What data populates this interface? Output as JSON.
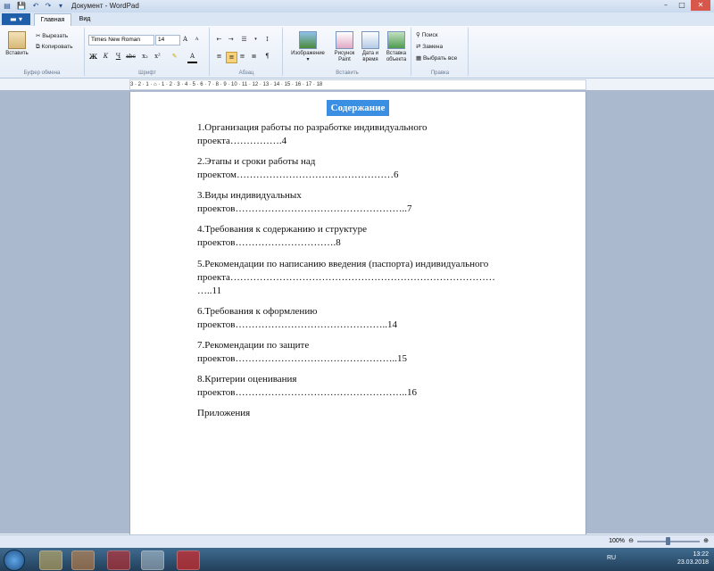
{
  "window": {
    "title": "Документ - WordPad",
    "min": "–",
    "max": "□",
    "close": "✕"
  },
  "tabs": {
    "file": "▬ ▾",
    "home": "Главная",
    "view": "Вид"
  },
  "ribbon": {
    "clipboard": {
      "label": "Буфер обмена",
      "paste": "Вставить",
      "cut": "Вырезать",
      "copy": "Копировать"
    },
    "font": {
      "label": "Шрифт",
      "family": "Times New Roman",
      "size": "14",
      "bold": "Ж",
      "italic": "К",
      "underline": "Ч",
      "strike": "abc",
      "sub": "x₂",
      "sup": "x²",
      "highlight": "✎",
      "color": "A"
    },
    "paragraph": {
      "label": "Абзац"
    },
    "insert": {
      "label": "Вставить",
      "image": "Изображение",
      "paint_line1": "Рисунок",
      "paint_line2": "Paint",
      "date_line1": "Дата и",
      "date_line2": "время",
      "object_line1": "Вставка",
      "object_line2": "объекта"
    },
    "editing": {
      "label": "Правка",
      "find": "Поиск",
      "replace": "Замена",
      "select_all": "Выбрать все"
    }
  },
  "ruler": "3 · 2 · 1 · ⌂ · 1 · 2 · 3 · 4 · 5 · 6 · 7 · 8 · 9 · 10 · 11 · 12 · 13 · 14 · 15 · 16 · 17 · 18",
  "document": {
    "heading": "Содержание",
    "items": [
      {
        "line1": "1.Организация работы по разработке индивидуального",
        "line2": "проекта…………….4",
        "line3": ""
      },
      {
        "line1": "2.Этапы и сроки работы над",
        "line2": "проектом…………………………………………6",
        "line3": ""
      },
      {
        "line1": "3.Виды индивидуальных",
        "line2": "проектов……………………………………………..7",
        "line3": ""
      },
      {
        "line1": "4.Требования к содержанию и структуре",
        "line2": "проектов………………………….8",
        "line3": ""
      },
      {
        "line1": "5.Рекомендации по написанию введения (паспорта)  индивидуального",
        "line2": "проекта………………………………………………………………………",
        "line3": "…..11"
      },
      {
        "line1": "6.Требования к оформлению",
        "line2": "проектов………………………………………..14",
        "line3": ""
      },
      {
        "line1": "7.Рекомендации по защите",
        "line2": "проектов…………………………………………..15",
        "line3": ""
      },
      {
        "line1": "8.Критерии оценивания",
        "line2": "проектов……………………………………………..16",
        "line3": ""
      }
    ],
    "appendix": "Приложения"
  },
  "status": {
    "zoom": "100%",
    "zoom_out": "⊖",
    "zoom_in": "⊕",
    "zoom_fraction": 0.5
  },
  "taskbar": {
    "lang": "RU",
    "time": "13:22",
    "date": "23.03.2018"
  }
}
